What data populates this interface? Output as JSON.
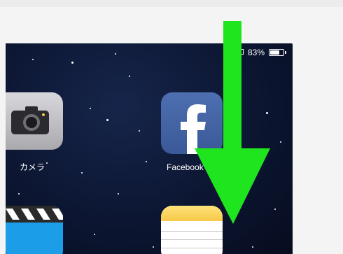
{
  "status_bar": {
    "battery_text": "83%",
    "battery_level": 0.83,
    "icons": [
      "location-arrow-icon",
      "airplay-icon",
      "battery-icon"
    ]
  },
  "apps": [
    {
      "name": "camera",
      "label": "カメラ",
      "icon": "camera-icon"
    },
    {
      "name": "facebook",
      "label": "Facebook",
      "icon": "facebook-icon"
    },
    {
      "name": "videos",
      "label": "",
      "icon": "clapperboard-icon"
    },
    {
      "name": "notes",
      "label": "",
      "icon": "notes-icon"
    }
  ],
  "overlay": {
    "icon": "down-arrow-icon",
    "color": "#1fe51f"
  },
  "colors": {
    "wallpaper": "#0c1632",
    "facebook": "#3b5998",
    "notes_band": "#f7c948",
    "videos": "#1c9de8"
  }
}
